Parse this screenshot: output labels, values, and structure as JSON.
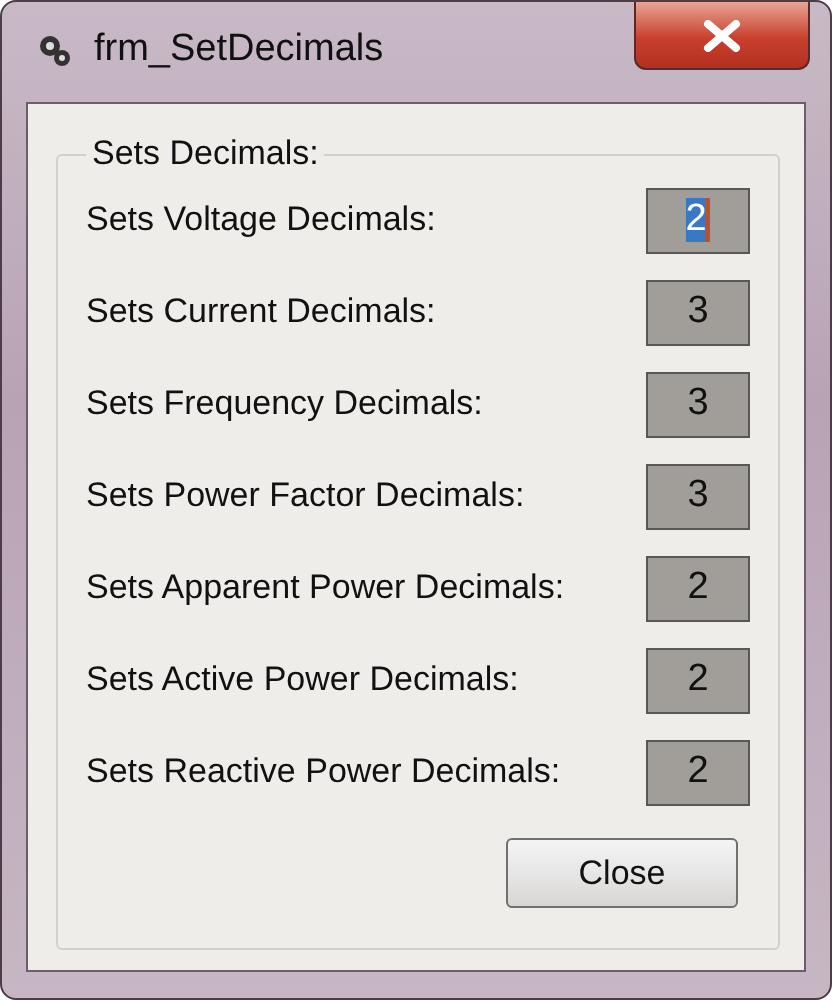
{
  "window": {
    "title": "frm_SetDecimals"
  },
  "group": {
    "title": "Sets Decimals:"
  },
  "rows": [
    {
      "label": "Sets Voltage Decimals:",
      "value": "2",
      "focused": true
    },
    {
      "label": "Sets Current Decimals:",
      "value": "3",
      "focused": false
    },
    {
      "label": "Sets Frequency Decimals:",
      "value": "3",
      "focused": false
    },
    {
      "label": "Sets Power Factor Decimals:",
      "value": "3",
      "focused": false
    },
    {
      "label": "Sets Apparent Power Decimals:",
      "value": "2",
      "focused": false
    },
    {
      "label": "Sets Active Power Decimals:",
      "value": "2",
      "focused": false
    },
    {
      "label": "Sets Reactive Power Decimals:",
      "value": "2",
      "focused": false
    }
  ],
  "buttons": [
    "Close"
  ]
}
